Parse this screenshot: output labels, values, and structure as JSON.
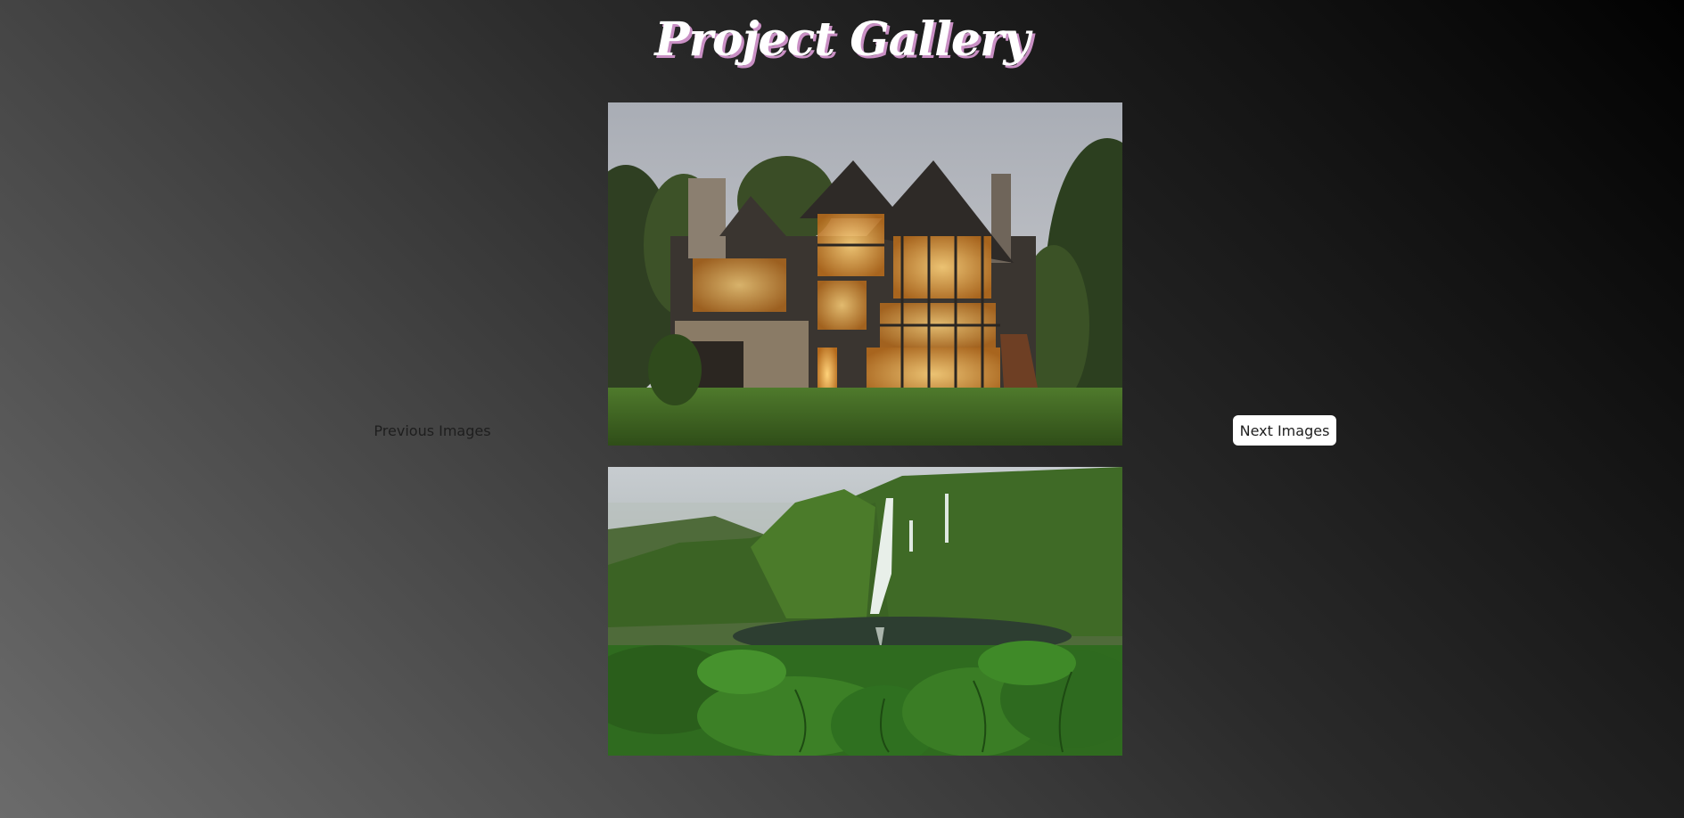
{
  "page": {
    "title": "Project Gallery"
  },
  "navigation": {
    "previous_label": "Previous Images",
    "next_label": "Next Images"
  },
  "gallery": {
    "images": [
      {
        "subject": "modern-stone-house-at-dusk"
      },
      {
        "subject": "green-valley-with-waterfall-and-lake"
      }
    ]
  },
  "colors": {
    "title_text": "#ffffff",
    "title_shadow": "#c98fc4",
    "background_dark": "#020202",
    "background_light": "#6b6b6b",
    "next_button_bg": "#ffffff"
  }
}
